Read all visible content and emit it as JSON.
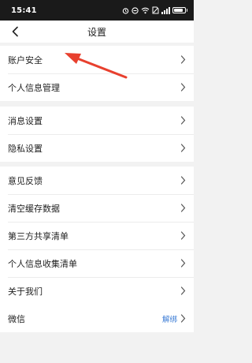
{
  "status_bar": {
    "time": "15:41",
    "battery_level": 0.9,
    "icons": [
      "alarm-icon",
      "do-not-disturb-icon",
      "wifi-icon",
      "sim-disabled-icon",
      "signal-icon",
      "battery-icon"
    ]
  },
  "nav": {
    "title": "设置",
    "back_icon": "chevron-left-icon"
  },
  "groups": [
    {
      "items": [
        {
          "label": "账户安全"
        },
        {
          "label": "个人信息管理"
        }
      ]
    },
    {
      "items": [
        {
          "label": "消息设置"
        },
        {
          "label": "隐私设置"
        }
      ]
    },
    {
      "items": [
        {
          "label": "意见反馈"
        },
        {
          "label": "清空缓存数据"
        },
        {
          "label": "第三方共享清单"
        },
        {
          "label": "个人信息收集清单"
        },
        {
          "label": "关于我们"
        }
      ]
    },
    {
      "items": [
        {
          "label": "微信",
          "value": "解绑"
        }
      ]
    }
  ],
  "colors": {
    "annotation_arrow": "#e8402e",
    "link_value": "#3a7bd5",
    "background": "#f2f2f2"
  }
}
